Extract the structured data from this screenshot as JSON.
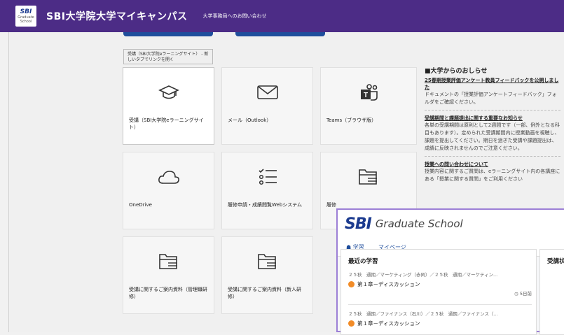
{
  "header": {
    "logo_main": "SBI",
    "logo_sub": "Graduate School",
    "title": "SBI大学院大学マイキャンパス",
    "contact_link": "大学事務局へのお問い合わせ",
    "bg_color": "#4c2c86"
  },
  "tooltip": "受講（SBI大学院eラーニングサイト） - 新しいタブでリンクを開く",
  "tiles": [
    {
      "label": "受講（SBI大学院eラーニングサイト）",
      "icon": "graduation-cap-icon"
    },
    {
      "label": "メール（Outlook）",
      "icon": "mail-icon"
    },
    {
      "label": "Teams（ブラウザ版）",
      "icon": "teams-icon"
    },
    {
      "label": "OneDrive",
      "icon": "cloud-icon"
    },
    {
      "label": "履修申請・成績閲覧Webシステム",
      "icon": "list-icon"
    },
    {
      "label": "履修",
      "icon": "folder-icon"
    },
    {
      "label": "受講に関するご案内資料（管理職研修）",
      "icon": "folder-icon"
    },
    {
      "label": "受講に関するご案内資料（新人研修）",
      "icon": "folder-icon"
    }
  ],
  "news": {
    "heading": "■大学からのおしらせ",
    "items": [
      {
        "title": "25春期授業評価アンケート教員フィードバックを公開しました",
        "body": "ドキュメントの「授業評価アンケートフィードバック」フォルダをご確認ください。"
      },
      {
        "title": "受講期間と課題提出に関する重要なお知らせ",
        "body": "各単の受講期間は原則として2週間です（一部、例外となる科目もあります）。定められた受講期間内に授業動画を視聴し、課題を提出してください。期日を過ぎた受講や課題提出は、成績に反映されませんのでご注意ください。"
      },
      {
        "title": "授業への問い合わせについて",
        "body": "授業内容に関するご質問は、eラーニングサイト内の各講座にある「授業に関する質問」をご利用ください"
      }
    ]
  },
  "overlay": {
    "logo_main": "SBI",
    "logo_sub": "Graduate School",
    "nav": {
      "study": "☗ 学習",
      "mypage": "マイページ"
    },
    "recent_title": "最近の学習",
    "side_title": "受講状",
    "items": [
      {
        "path": "２５秋　通期／マーケティング（赤岡）／２５秋　通期／マーケティン...",
        "topic": "第１章－ディスカッション",
        "time": "5日前"
      },
      {
        "path": "２５秋　通期／ファイナンス（石川）／２５秋　通期／ファイナンス（...",
        "topic": "第１章－ディスカッション",
        "time": ""
      }
    ]
  }
}
